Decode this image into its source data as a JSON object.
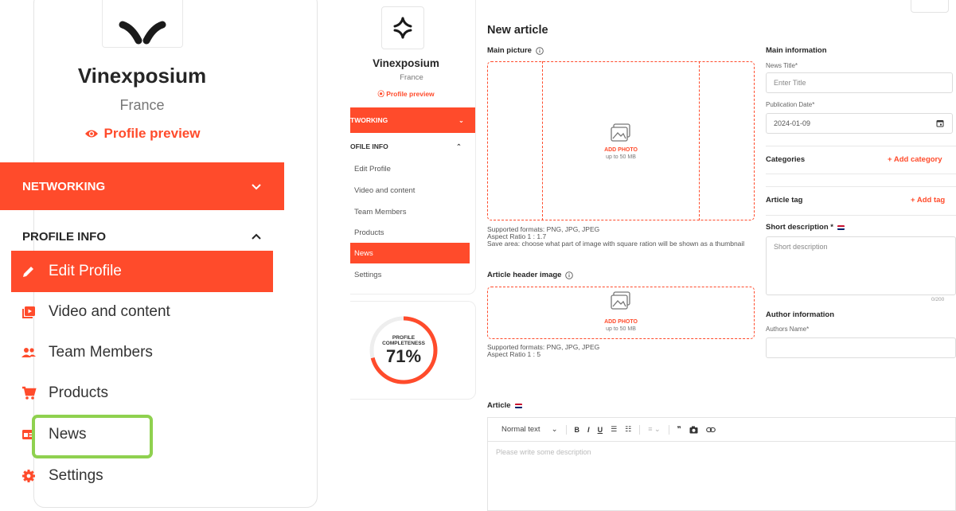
{
  "company": {
    "name": "Vinexposium",
    "country": "France",
    "profile_preview": "Profile preview"
  },
  "menu": {
    "networking": "NETWORKING",
    "profile_info": "PROFILE INFO",
    "items": [
      {
        "label": "Edit Profile",
        "icon": "pencil-icon"
      },
      {
        "label": "Video and content",
        "icon": "video-library-icon"
      },
      {
        "label": "Team Members",
        "icon": "people-icon"
      },
      {
        "label": "Products",
        "icon": "cart-icon"
      },
      {
        "label": "News",
        "icon": "news-icon"
      },
      {
        "label": "Settings",
        "icon": "gear-icon"
      }
    ],
    "zoom_active": "Edit Profile",
    "small_active": "News",
    "highlighted": "News"
  },
  "small_menu": {
    "networking": "TWORKING",
    "profile_info": "OFILE INFO"
  },
  "completeness": {
    "label_line1": "PROFILE",
    "label_line2": "COMPLETENESS",
    "value": "71%",
    "fraction": 0.71
  },
  "form": {
    "title": "New article",
    "main_picture": {
      "label": "Main picture",
      "add_photo": "ADD PHOTO",
      "limit": "up to 50 MB",
      "formats": "Supported formats: PNG, JPG, JPEG",
      "ratio": "Aspect Ratio 1 : 1.7",
      "save_area": "Save area: choose what part of image with square ration will be shown as a thumbnail"
    },
    "header_image": {
      "label": "Article header image",
      "add_photo": "ADD PHOTO",
      "limit": "up to 50 MB",
      "formats": "Supported formats: PNG, JPG, JPEG",
      "ratio": "Aspect Ratio 1 : 5"
    },
    "main_info": {
      "heading": "Main information",
      "news_title_label": "News Title*",
      "news_title_placeholder": "Enter Title",
      "pub_date_label": "Publication Date*",
      "pub_date_value": "2024-01-09"
    },
    "categories": {
      "label": "Categories",
      "add": "+ Add category"
    },
    "article_tag": {
      "label": "Article tag",
      "add": "+ Add tag"
    },
    "short_description": {
      "label": "Short description *",
      "placeholder": "Short description",
      "counter": "0/200"
    },
    "author": {
      "heading": "Author information",
      "name_label": "Authors Name*"
    },
    "article": {
      "label": "Article",
      "text_style": "Normal text",
      "placeholder": "Please write some description"
    }
  },
  "colors": {
    "accent": "#ff4b2b",
    "highlight": "#8fd14f"
  }
}
